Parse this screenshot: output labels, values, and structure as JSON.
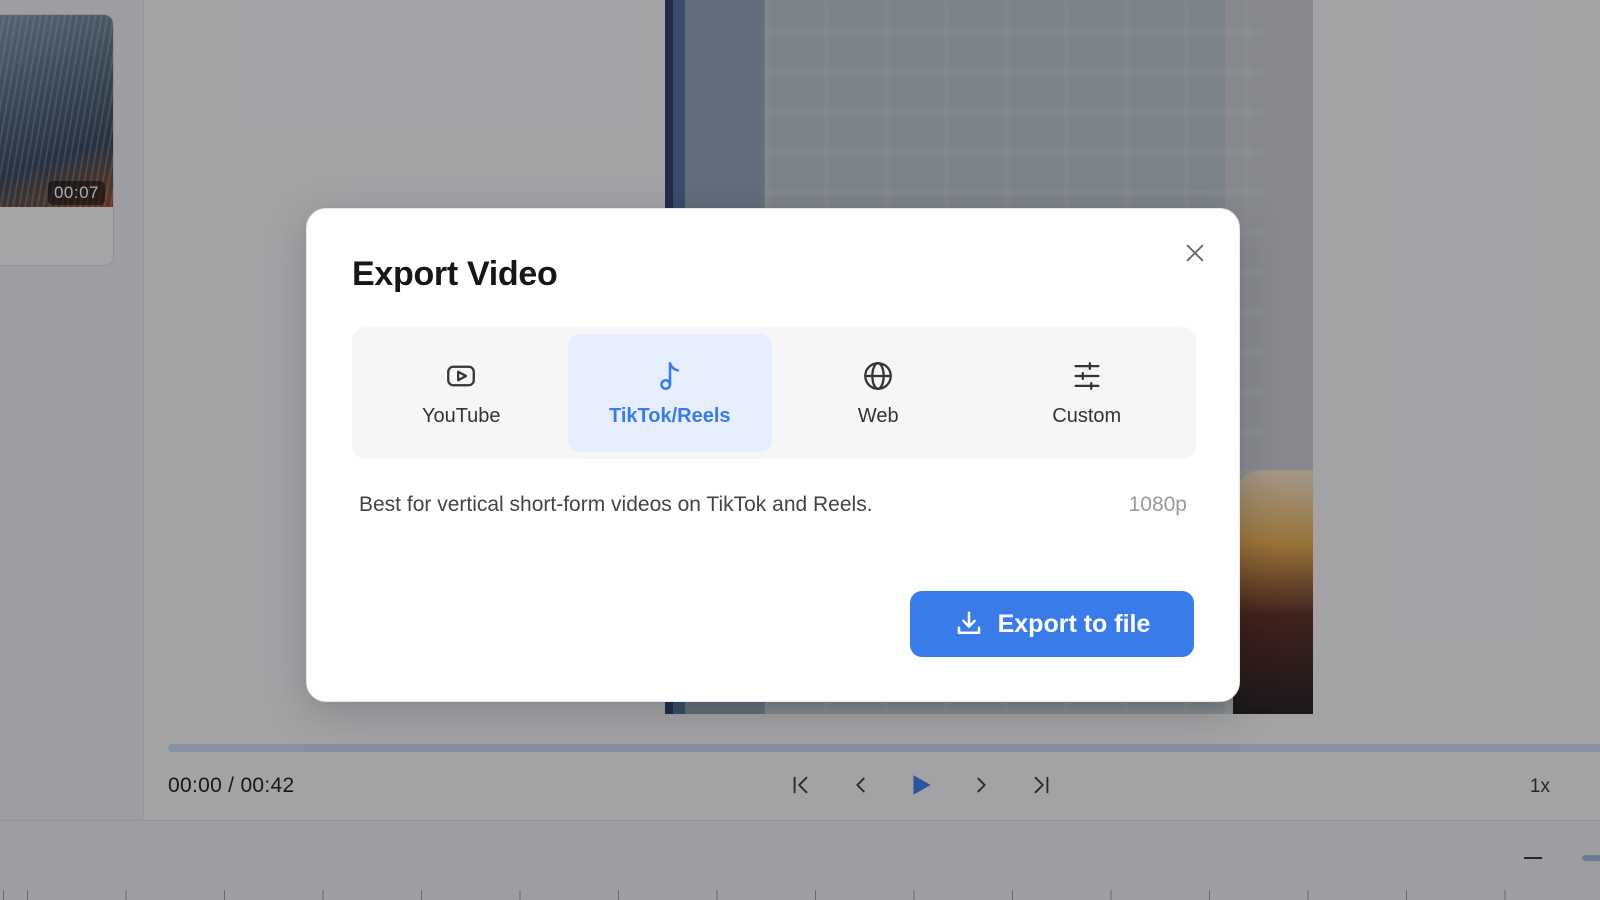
{
  "background": {
    "clip": {
      "duration": "00:07"
    },
    "playback": {
      "timecode": "00:00 / 00:42",
      "progress_percent": 0,
      "speed": "1x"
    }
  },
  "dialog": {
    "title": "Export Video",
    "presets": [
      {
        "id": "youtube",
        "label": "YouTube",
        "icon": "youtube-icon",
        "selected": false
      },
      {
        "id": "tiktok",
        "label": "TikTok/Reels",
        "icon": "music-note-icon",
        "selected": true
      },
      {
        "id": "web",
        "label": "Web",
        "icon": "globe-icon",
        "selected": false
      },
      {
        "id": "custom",
        "label": "Custom",
        "icon": "sliders-icon",
        "selected": false
      }
    ],
    "description": "Best for vertical short-form videos on TikTok and Reels.",
    "resolution": "1080p",
    "export_label": "Export to file"
  },
  "colors": {
    "accent": "#3a7bea",
    "selected_tab_bg": "#e7eefb",
    "muted_text": "#9a9a9a"
  }
}
